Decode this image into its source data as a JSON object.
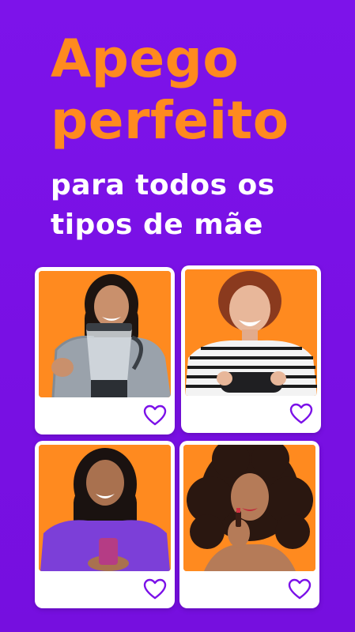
{
  "headline": {
    "line1": "Apego",
    "line2": "perfeito"
  },
  "subheadline": {
    "line1": "para todos os",
    "line2": "tipos de mãe"
  },
  "colors": {
    "background": "#7b11e8",
    "headline": "#ff8a1f",
    "subheadline": "#ffffff",
    "photo_background": "#ff8a1f",
    "heart_outline": "#7b11e8",
    "card": "#ffffff"
  },
  "cards": [
    {
      "photo": "woman-with-blender-photo",
      "icon": "heart-icon"
    },
    {
      "photo": "woman-with-game-controller-photo",
      "icon": "heart-icon"
    },
    {
      "photo": "woman-with-phone-photo",
      "icon": "heart-icon"
    },
    {
      "photo": "woman-with-lipstick-photo",
      "icon": "heart-icon"
    }
  ]
}
